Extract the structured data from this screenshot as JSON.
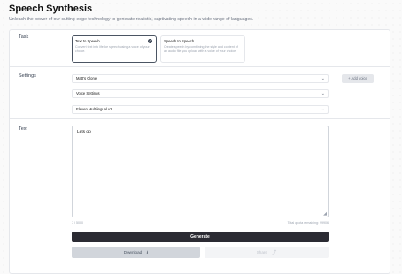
{
  "header": {
    "title": "Speech Synthesis",
    "subtitle": "Unleash the power of our cutting-edge technology to generate realistic, captivating speech in a wide range of languages."
  },
  "task": {
    "label": "Task",
    "options": [
      {
        "title": "Text to Speech",
        "desc": "Convert text into lifelike speech using a voice of your choice."
      },
      {
        "title": "Speech to Speech",
        "desc": "Create speech by combining the style and content of an audio file you upload with a voice of your choice."
      }
    ],
    "selected_index": 0
  },
  "settings": {
    "label": "Settings",
    "voice": "Matt's Clone",
    "voice_settings": "Voice Settings",
    "model": "Eleven Multilingual v2",
    "add_voice": "Add voice"
  },
  "text": {
    "label": "Text",
    "value": "Lets go",
    "counter": "7 / 5000",
    "remaining": "Total quota remaining: 99906"
  },
  "actions": {
    "generate": "Generate",
    "download": "Download",
    "share": "Share"
  },
  "icons": {
    "check": "check-icon",
    "chevron": "chevron-down-icon",
    "plus": "plus-icon",
    "download": "download-icon",
    "share": "share-icon"
  }
}
